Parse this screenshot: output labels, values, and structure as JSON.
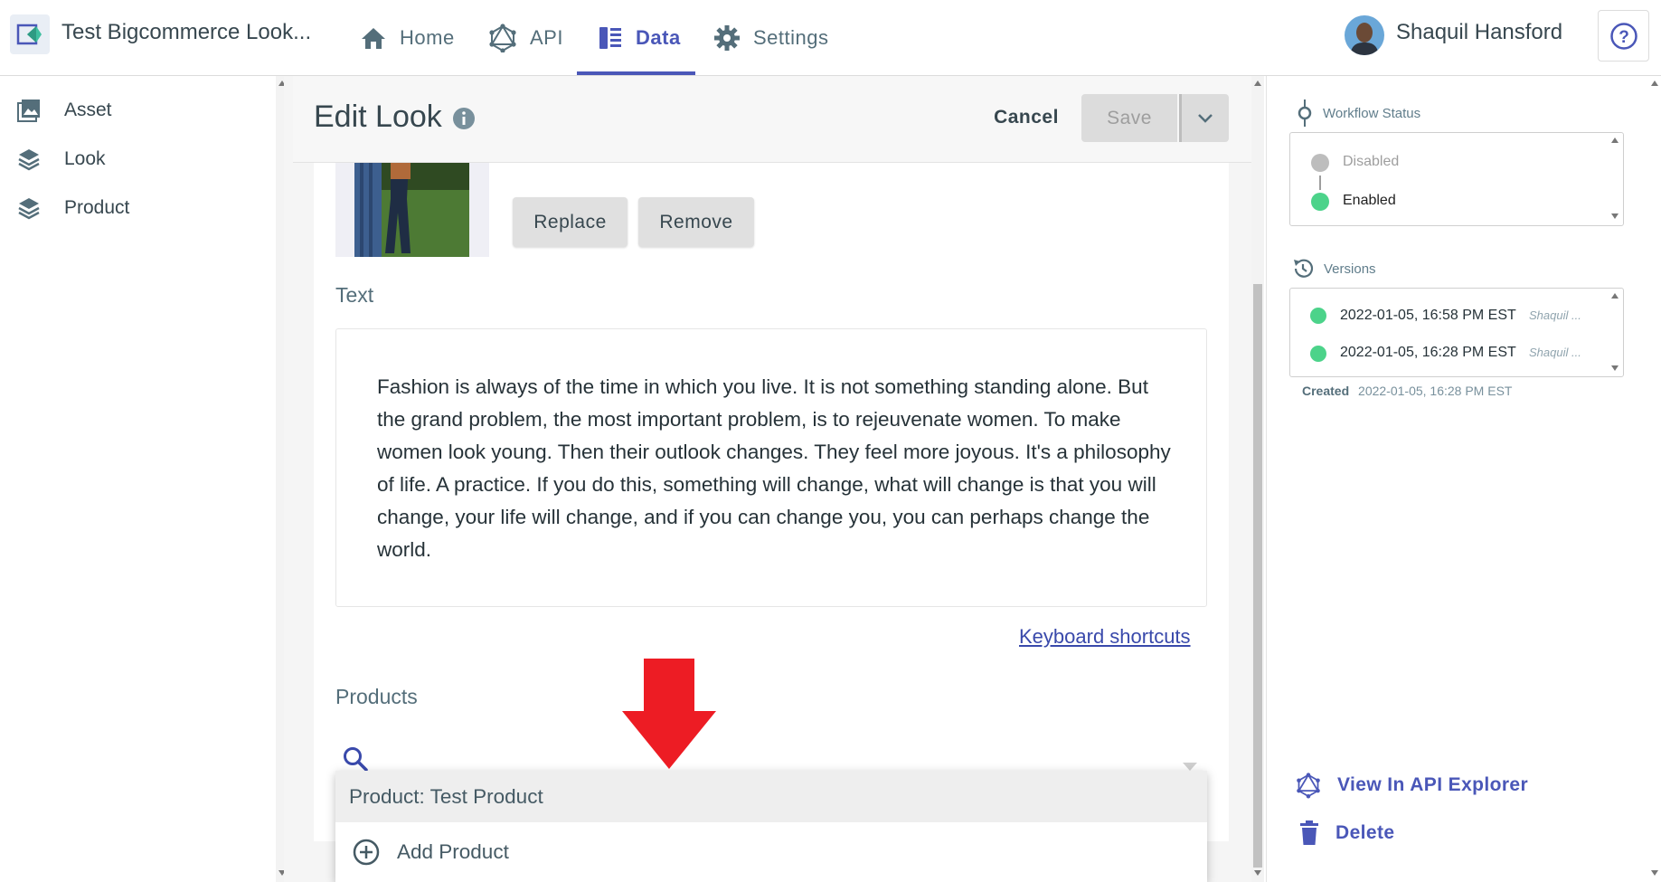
{
  "app": {
    "title": "Test Bigcommerce Look..."
  },
  "nav": {
    "home": "Home",
    "api": "API",
    "data": "Data",
    "settings": "Settings"
  },
  "user": {
    "name": "Shaquil Hansford"
  },
  "sidebar": {
    "items": [
      {
        "label": "Asset",
        "icon": "image-icon"
      },
      {
        "label": "Look",
        "icon": "layers-icon"
      },
      {
        "label": "Product",
        "icon": "layers-icon"
      }
    ]
  },
  "editor": {
    "title": "Edit Look",
    "cancel_label": "Cancel",
    "save_label": "Save",
    "replace_label": "Replace",
    "remove_label": "Remove",
    "text_label": "Text",
    "text_content": "Fashion is always of the time in which you live. It is not something standing alone. But the grand problem, the most important problem, is to rejeuvenate women. To make women look young. Then their outlook changes. They feel more joyous. It's a philosophy of life. A practice. If you do this, something will change, what will change is that you will change, your life will change, and if you can change you, you can perhaps change the world.",
    "keyboard_shortcuts": "Keyboard shortcuts",
    "products_label": "Products",
    "dropdown_options": [
      "Product: Test Product",
      "Add Product"
    ]
  },
  "workflow": {
    "label": "Workflow Status",
    "states": [
      "Disabled",
      "Enabled"
    ],
    "active_state": "Enabled"
  },
  "versions": {
    "label": "Versions",
    "items": [
      {
        "date": "2022-01-05, 16:58 PM EST",
        "user": "Shaquil ..."
      },
      {
        "date": "2022-01-05, 16:28 PM EST",
        "user": "Shaquil ..."
      }
    ],
    "created_label": "Created",
    "created_value": "2022-01-05, 16:28 PM EST"
  },
  "actions": {
    "view_api": "View In API Explorer",
    "delete": "Delete"
  },
  "colors": {
    "accent": "#4a57b8",
    "status_green": "#4cd38a",
    "status_gray": "#bdbdbd",
    "arrow_red": "#ed1c24"
  }
}
